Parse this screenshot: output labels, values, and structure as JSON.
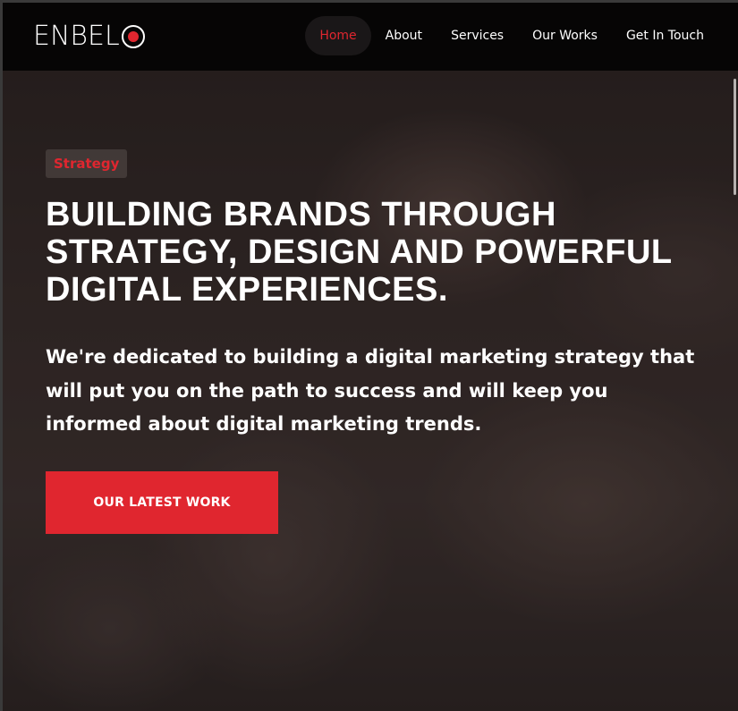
{
  "brand": {
    "logo_text": "ENBEL",
    "logo_mark": "O",
    "accent_color": "#e0262f"
  },
  "nav": {
    "items": [
      {
        "label": "Home",
        "active": true
      },
      {
        "label": "About",
        "active": false
      },
      {
        "label": "Services",
        "active": false
      },
      {
        "label": "Our Works",
        "active": false
      },
      {
        "label": "Get In Touch",
        "active": false
      }
    ]
  },
  "hero": {
    "badge": "Strategy",
    "headline": "BUILDING BRANDS THROUGH STRATEGY, DESIGN AND POWERFUL DIGITAL EXPERIENCES.",
    "subtext": "We're dedicated to building a digital marketing strategy that will put you on the path to success and will keep you informed about digital marketing trends.",
    "cta_label": "OUR LATEST WORK"
  }
}
